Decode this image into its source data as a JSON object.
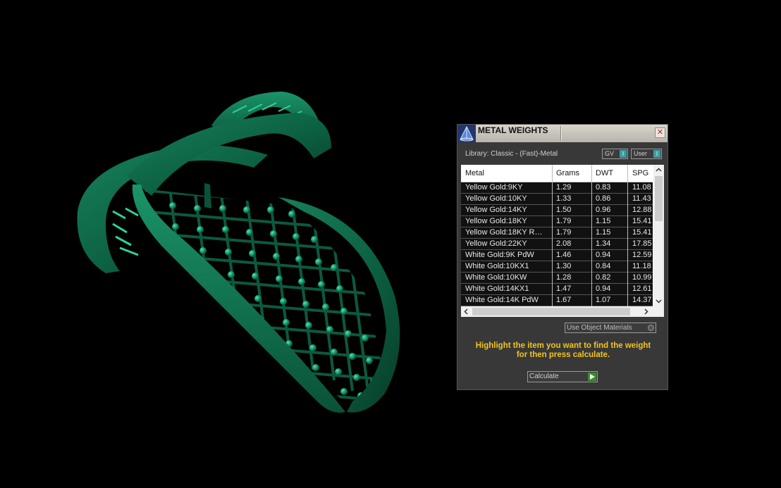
{
  "panel": {
    "title": "METAL WEIGHTS",
    "close_label": "✕",
    "library_label": "Library: Classic - (Fast)-Metal",
    "gv_label": "GV",
    "user_label": "User",
    "toggle_mark": "I",
    "table": {
      "headers": [
        "Metal",
        "Grams",
        "DWT",
        "SPG"
      ],
      "rows": [
        [
          "Yellow Gold:9KY",
          "1.29",
          "0.83",
          "11.08"
        ],
        [
          "Yellow Gold:10KY",
          "1.33",
          "0.86",
          "11.43"
        ],
        [
          "Yellow Gold:14KY",
          "1.50",
          "0.96",
          "12.88"
        ],
        [
          "Yellow Gold:18KY",
          "1.79",
          "1.15",
          "15.41"
        ],
        [
          "Yellow Gold:18KY R…",
          "1.79",
          "1.15",
          "15.41"
        ],
        [
          "Yellow Gold:22KY",
          "2.08",
          "1.34",
          "17.85"
        ],
        [
          "White Gold:9K PdW",
          "1.46",
          "0.94",
          "12.59"
        ],
        [
          "White Gold:10KX1",
          "1.30",
          "0.84",
          "11.18"
        ],
        [
          "White Gold:10KW",
          "1.28",
          "0.82",
          "10.99"
        ],
        [
          "White Gold:14KX1",
          "1.47",
          "0.94",
          "12.61"
        ],
        [
          "White Gold:14K PdW",
          "1.67",
          "1.07",
          "14.37"
        ]
      ]
    },
    "use_object_materials_label": "Use Object Materials",
    "hint_line1": "Highlight the item you want to find the weight",
    "hint_line2": "for then press calculate.",
    "calculate_label": "Calculate"
  },
  "colors": {
    "background": "#000000",
    "panel_bg": "#383838",
    "ring_green": "#0f6e4c",
    "hint_yellow": "#f3c418",
    "accent_teal": "#3d9ca2"
  },
  "icons": {
    "app": "pyramid-app-icon",
    "close": "close-icon",
    "go": "play-arrow-icon"
  }
}
